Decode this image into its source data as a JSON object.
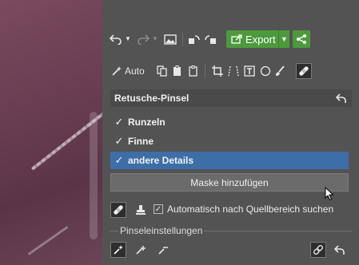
{
  "toolbar": {
    "undo_icon": "undo-icon",
    "redo_icon": "redo-icon",
    "export_label": "Export",
    "auto_label": "Auto"
  },
  "retouch": {
    "title": "Retusche-Pinsel",
    "items": [
      {
        "label": "Runzeln",
        "checked": true
      },
      {
        "label": "Finne",
        "checked": true
      },
      {
        "label": "andere Details",
        "checked": true,
        "selected": true
      }
    ],
    "add_mask_label": "Maske hinzufügen",
    "auto_source_label": "Automatisch nach Quellbereich suchen",
    "auto_source_checked": true,
    "brush_settings_label": "Pinseleinstellungen"
  },
  "colors": {
    "accent_green": "#4d9a3c",
    "selection_blue": "#3d6ea8",
    "panel_bg": "#535353"
  }
}
